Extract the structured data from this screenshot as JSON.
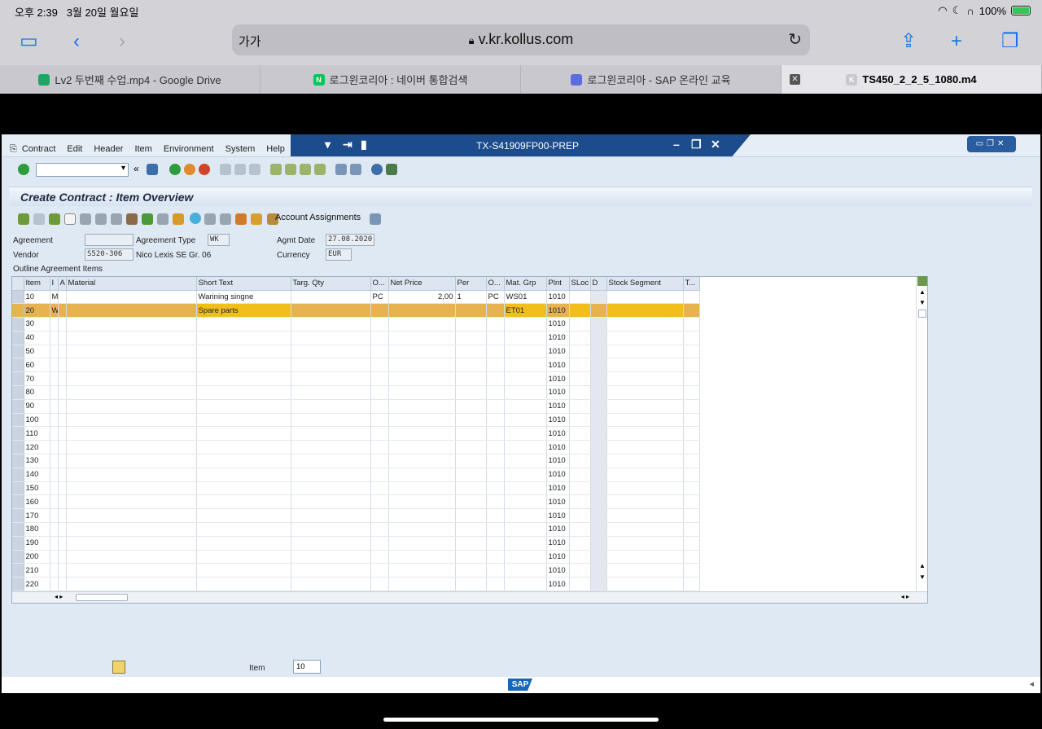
{
  "status": {
    "time": "오후 2:39",
    "date": "3월 20일 월요일",
    "battery": "100%"
  },
  "safari": {
    "aa": "가가",
    "url": "v.kr.kollus.com"
  },
  "tabs": [
    {
      "label": "Lv2 두번째 수업.mp4 - Google Drive",
      "fav_color": "#1fa463"
    },
    {
      "label": "로그윈코리아 : 네이버 통합검색",
      "fav": "N",
      "fav_color": "#03c75a"
    },
    {
      "label": "로그윈코리아 - SAP 온라인 교육",
      "fav_color": "#5b6ee1"
    },
    {
      "label": "TS450_2_2_5_1080.m4",
      "fav": "K",
      "fav_color": "#c9c9d0",
      "active": true
    }
  ],
  "sap": {
    "menu": [
      "Contract",
      "Edit",
      "Header",
      "Item",
      "Environment",
      "System",
      "Help"
    ],
    "window_title": "TX-S41909FP00-PREP",
    "screen_title": "Create Contract : Item Overview",
    "account_assignments": "Account Assignments",
    "header": {
      "agreement_label": "Agreement",
      "agreement": "",
      "agreement_type_label": "Agreement Type",
      "agreement_type": "WK",
      "agmt_date_label": "Agmt Date",
      "agmt_date": "27.08.2020",
      "vendor_label": "Vendor",
      "vendor": "S520-306",
      "vendor_name": "Nico Lexis SE Gr. 06",
      "currency_label": "Currency",
      "currency": "EUR"
    },
    "outline_label": "Outline Agreement Items",
    "columns": [
      "Item",
      "I",
      "A",
      "Material",
      "Short Text",
      "Targ. Qty",
      "O...",
      "Net Price",
      "Per",
      "O...",
      "Mat. Grp",
      "Plnt",
      "SLoc",
      "D",
      "Stock Segment",
      "T..."
    ],
    "rows": [
      [
        "10",
        "M",
        "",
        "",
        "Warining singne",
        "",
        "PC",
        "2,00",
        "1",
        "PC",
        "WS01",
        "1010",
        "",
        "",
        "",
        ""
      ],
      [
        "20",
        "W",
        "",
        "",
        "Spare parts",
        "",
        "",
        "",
        "",
        "",
        "ET01",
        "1010",
        "",
        "",
        "",
        ""
      ],
      [
        "30",
        "",
        "",
        "",
        "",
        "",
        "",
        "",
        "",
        "",
        "",
        "1010",
        "",
        "",
        "",
        ""
      ],
      [
        "40",
        "",
        "",
        "",
        "",
        "",
        "",
        "",
        "",
        "",
        "",
        "1010",
        "",
        "",
        "",
        ""
      ],
      [
        "50",
        "",
        "",
        "",
        "",
        "",
        "",
        "",
        "",
        "",
        "",
        "1010",
        "",
        "",
        "",
        ""
      ],
      [
        "60",
        "",
        "",
        "",
        "",
        "",
        "",
        "",
        "",
        "",
        "",
        "1010",
        "",
        "",
        "",
        ""
      ],
      [
        "70",
        "",
        "",
        "",
        "",
        "",
        "",
        "",
        "",
        "",
        "",
        "1010",
        "",
        "",
        "",
        ""
      ],
      [
        "80",
        "",
        "",
        "",
        "",
        "",
        "",
        "",
        "",
        "",
        "",
        "1010",
        "",
        "",
        "",
        ""
      ],
      [
        "90",
        "",
        "",
        "",
        "",
        "",
        "",
        "",
        "",
        "",
        "",
        "1010",
        "",
        "",
        "",
        ""
      ],
      [
        "100",
        "",
        "",
        "",
        "",
        "",
        "",
        "",
        "",
        "",
        "",
        "1010",
        "",
        "",
        "",
        ""
      ],
      [
        "110",
        "",
        "",
        "",
        "",
        "",
        "",
        "",
        "",
        "",
        "",
        "1010",
        "",
        "",
        "",
        ""
      ],
      [
        "120",
        "",
        "",
        "",
        "",
        "",
        "",
        "",
        "",
        "",
        "",
        "1010",
        "",
        "",
        "",
        ""
      ],
      [
        "130",
        "",
        "",
        "",
        "",
        "",
        "",
        "",
        "",
        "",
        "",
        "1010",
        "",
        "",
        "",
        ""
      ],
      [
        "140",
        "",
        "",
        "",
        "",
        "",
        "",
        "",
        "",
        "",
        "",
        "1010",
        "",
        "",
        "",
        ""
      ],
      [
        "150",
        "",
        "",
        "",
        "",
        "",
        "",
        "",
        "",
        "",
        "",
        "1010",
        "",
        "",
        "",
        ""
      ],
      [
        "160",
        "",
        "",
        "",
        "",
        "",
        "",
        "",
        "",
        "",
        "",
        "1010",
        "",
        "",
        "",
        ""
      ],
      [
        "170",
        "",
        "",
        "",
        "",
        "",
        "",
        "",
        "",
        "",
        "",
        "1010",
        "",
        "",
        "",
        ""
      ],
      [
        "180",
        "",
        "",
        "",
        "",
        "",
        "",
        "",
        "",
        "",
        "",
        "1010",
        "",
        "",
        "",
        ""
      ],
      [
        "190",
        "",
        "",
        "",
        "",
        "",
        "",
        "",
        "",
        "",
        "",
        "1010",
        "",
        "",
        "",
        ""
      ],
      [
        "200",
        "",
        "",
        "",
        "",
        "",
        "",
        "",
        "",
        "",
        "",
        "1010",
        "",
        "",
        "",
        ""
      ],
      [
        "210",
        "",
        "",
        "",
        "",
        "",
        "",
        "",
        "",
        "",
        "",
        "1010",
        "",
        "",
        "",
        ""
      ],
      [
        "220",
        "",
        "",
        "",
        "",
        "",
        "",
        "",
        "",
        "",
        "",
        "1010",
        "",
        "",
        "",
        ""
      ]
    ],
    "highlight_row": 1,
    "item_label": "Item",
    "item_value": "10",
    "logo": "SAP"
  }
}
